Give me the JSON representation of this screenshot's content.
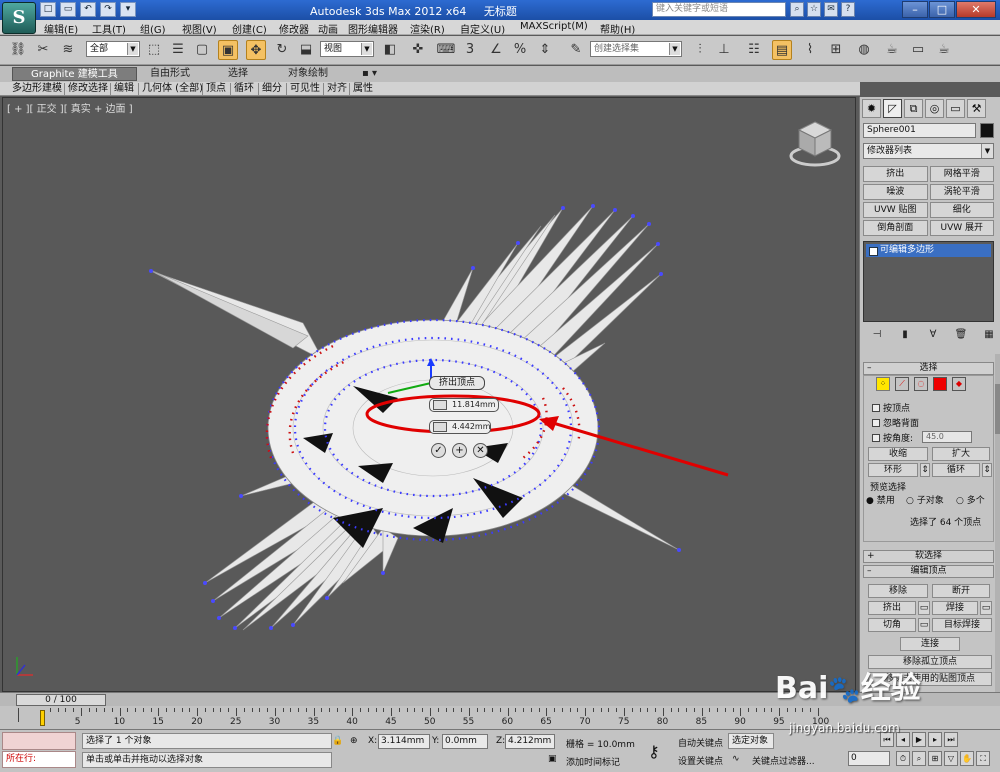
{
  "title_bar": {
    "app_name": "Autodesk 3ds Max  2012 x64",
    "document": "无标题",
    "search_placeholder": "键入关键字或短语",
    "logo_glyph": "S"
  },
  "quick_access": [
    "□",
    "▭",
    "↶",
    "↷",
    "▾"
  ],
  "menu": [
    "编辑(E)",
    "工具(T)",
    "组(G)",
    "视图(V)",
    "创建(C)",
    "修改器",
    "动画",
    "图形编辑器",
    "渲染(R)",
    "自定义(U)",
    "MAXScript(M)",
    "帮助(H)"
  ],
  "toolbar": {
    "selection_filter": "全部",
    "ref_coord": "视图",
    "named_selection": "创建选择集"
  },
  "ribbon": {
    "tabs": [
      "Graphite 建模工具",
      "自由形式",
      "选择",
      "对象绘制"
    ],
    "active_tab": "Graphite 建模工具",
    "items": [
      "多边形建模",
      "修改选择",
      "编辑",
      "几何体 (全部)",
      "顶点",
      "循环",
      "细分",
      "可见性",
      "对齐",
      "属性"
    ]
  },
  "viewport": {
    "label": "[ + ][ 正交 ][ 真实 + 边面 ]",
    "caddy": {
      "title": "挤出顶点",
      "height_value": "11.814mm",
      "width_value": "4.442mm",
      "ok": "✓",
      "apply": "+",
      "cancel": "✕"
    }
  },
  "command_panel": {
    "object_name": "Sphere001",
    "modifier_list": "修改器列表",
    "modifier_buttons": [
      "挤出",
      "网格平滑",
      "噪波",
      "涡轮平滑",
      "UVW 贴图",
      "细化",
      "倒角剖面",
      "UVW 展开"
    ],
    "stack_item": "可编辑多边形",
    "selection": {
      "title": "选择",
      "by_vertex": "按顶点",
      "ignore_backfacing": "忽略背面",
      "by_angle": "按角度:",
      "angle_value": "45.0",
      "shrink": "收缩",
      "grow": "扩大",
      "ring": "环形",
      "loop": "循环",
      "preview_title": "预览选择",
      "preview_options": [
        "禁用",
        "子对象",
        "多个"
      ],
      "status": "选择了 64 个顶点"
    },
    "soft_selection": "软选择",
    "edit_vertices": {
      "title": "编辑顶点",
      "remove": "移除",
      "break": "断开",
      "extrude": "挤出",
      "weld": "焊接",
      "chamfer": "切角",
      "target_weld": "目标焊接",
      "connect": "连接",
      "remove_isolated": "移除孤立顶点",
      "remove_unused_map": "移除未使用的贴图顶点"
    }
  },
  "timeline": {
    "frame_display": "0 / 100",
    "ruler_labels": [
      "0",
      "5",
      "10",
      "15",
      "20",
      "25",
      "30",
      "35",
      "40",
      "45",
      "50",
      "55",
      "60",
      "65",
      "70",
      "75",
      "80",
      "85",
      "90",
      "95",
      "100"
    ]
  },
  "status_bar": {
    "now_in": "所在行:",
    "selected": "选择了 1 个对象",
    "prompt": "单击或单击并拖动以选择对象",
    "x_label": "X:",
    "x": "3.114mm",
    "y_label": "Y:",
    "y": "0.0mm",
    "z_label": "Z:",
    "z": "4.212mm",
    "grid": "栅格 = 10.0mm",
    "add_time_tag": "添加时间标记",
    "auto_key": "自动关键点",
    "set_key": "设置关键点",
    "selected_objects": "选定对象",
    "key_filters": "关键点过滤器...",
    "current_frame": "0"
  },
  "watermark": {
    "brand": "Bai",
    "brand2": "经验",
    "url": "jingyan.baidu.com"
  }
}
